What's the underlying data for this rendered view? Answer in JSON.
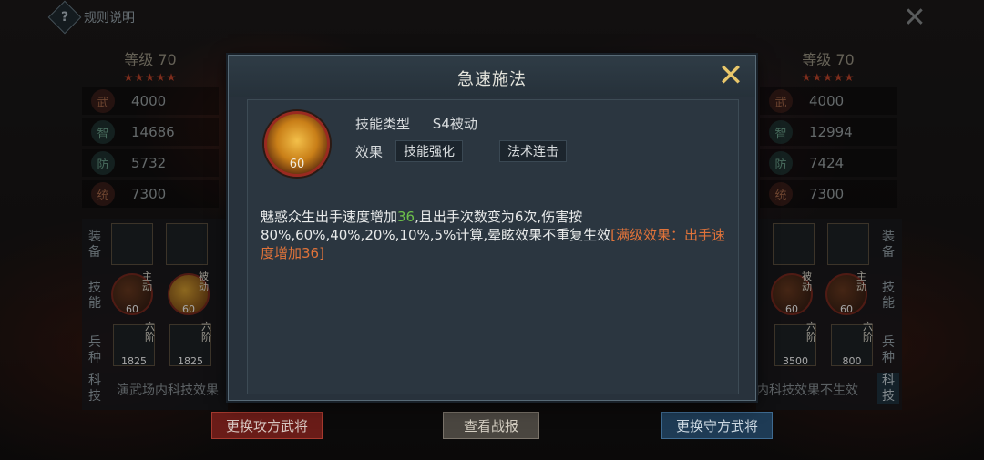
{
  "top": {
    "rules_icon": "?",
    "rules_label": "规则说明",
    "close_glyph": "✕"
  },
  "left": {
    "level": "等级 70",
    "stars": "★★★★★",
    "stats": [
      {
        "icon": "武",
        "value": "4000"
      },
      {
        "icon": "智",
        "value": "14686"
      },
      {
        "icon": "防",
        "value": "5732"
      },
      {
        "icon": "统",
        "value": "7300"
      }
    ],
    "labels": {
      "equip": "装备",
      "skill": "技能",
      "troop": "兵种",
      "tech": "科技"
    },
    "skill_tags": [
      "主动",
      "被动"
    ],
    "skill_levels": [
      "60",
      "60"
    ],
    "troop_tag": "六阶",
    "troop_counts": [
      "1825",
      "1825"
    ],
    "tech_text": "演武场内科技效果",
    "button": "更换攻方武将"
  },
  "right": {
    "level": "等级 70",
    "stars": "★★★★★",
    "stats": [
      {
        "icon": "武",
        "value": "4000"
      },
      {
        "icon": "智",
        "value": "12994"
      },
      {
        "icon": "防",
        "value": "7424"
      },
      {
        "icon": "统",
        "value": "7300"
      }
    ],
    "labels": {
      "equip": "装备",
      "skill": "技能",
      "troop": "兵种",
      "tech": "科技"
    },
    "skill_tags": [
      "被动",
      "主动"
    ],
    "skill_levels": [
      "60",
      "60"
    ],
    "troop_tag": "六阶",
    "troop_counts": [
      "3500",
      "800"
    ],
    "tech_text": "内科技效果不生效",
    "button": "更换守方武将"
  },
  "center_button": "查看战报",
  "modal": {
    "title": "急速施法",
    "close_glyph": "✕",
    "skill_level": "60",
    "type_label": "技能类型",
    "type_value": "S4被动",
    "effect_label": "效果",
    "effect_chips": [
      "技能强化",
      "法术连击"
    ],
    "desc_part1": "魅惑众生出手速度增加",
    "desc_value": "36",
    "desc_part2": ",且出手次数变为6次,伤害按80%,60%,40%,20%,10%,5%计算,晕眩效果不重复生效",
    "desc_max": "[满级效果：出手速度增加36]"
  },
  "colors": {
    "accent_gold": "#e9c76a",
    "highlight_green": "#6dc04a",
    "max_orange": "#e0733a",
    "star_red": "#c0452c"
  }
}
